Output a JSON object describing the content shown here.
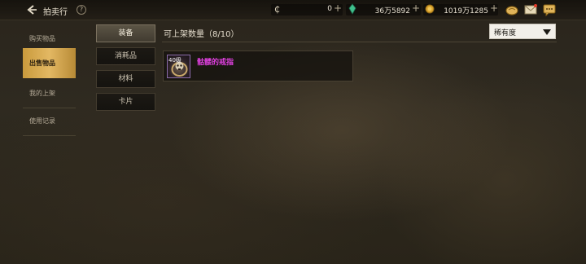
{
  "header": {
    "title": "拍卖行",
    "help": "?",
    "currencies": [
      {
        "name": "c-coin",
        "value": "0",
        "plus": "+"
      },
      {
        "name": "gem",
        "value": "36万5892",
        "plus": "+"
      },
      {
        "name": "gold",
        "value": "1019万1285",
        "plus": "+"
      }
    ],
    "icons": [
      "bread-icon",
      "mail-icon",
      "chat-icon"
    ]
  },
  "left_nav": {
    "items": [
      {
        "label": "购买物品",
        "active": false
      },
      {
        "label": "出售物品",
        "active": true
      },
      {
        "label": "我的上架",
        "active": false
      },
      {
        "label": "使用记录",
        "active": false
      }
    ]
  },
  "categories": [
    {
      "label": "装备",
      "active": true
    },
    {
      "label": "消耗品",
      "active": false
    },
    {
      "label": "材料",
      "active": false
    },
    {
      "label": "卡片",
      "active": false
    }
  ],
  "main": {
    "count_label": "可上架数量（8/10）",
    "sort": {
      "selected": "稀有度"
    },
    "items": [
      {
        "level": "40级",
        "name": "骷髅的戒指",
        "name_color": "#e040e0"
      }
    ]
  }
}
